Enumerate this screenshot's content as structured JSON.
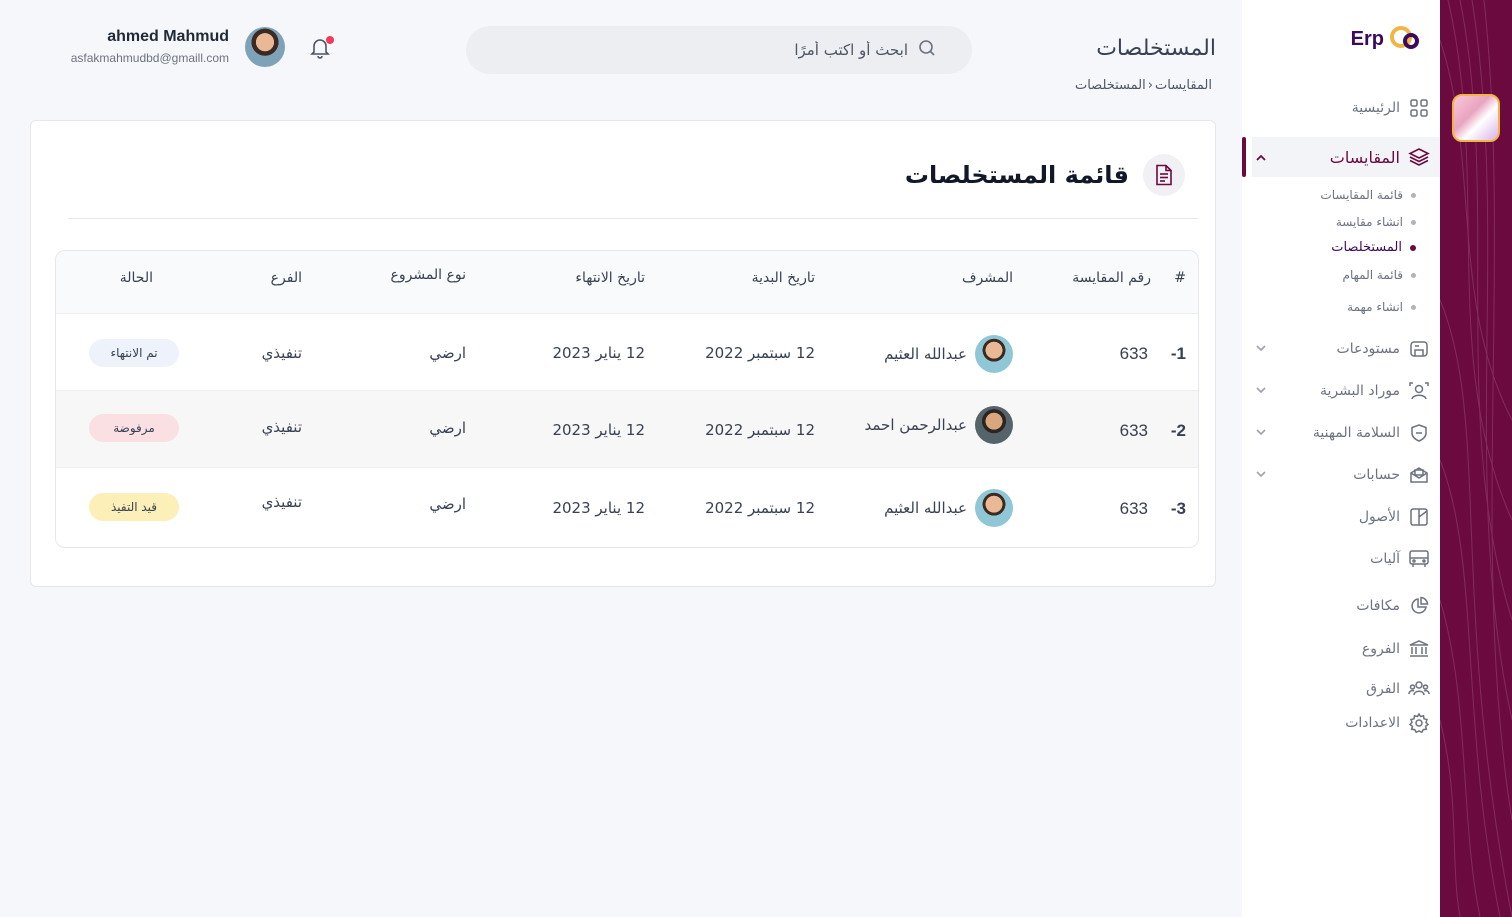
{
  "app": {
    "logo_text": "Erp"
  },
  "sidebar": {
    "items": [
      {
        "label": "الرئيسية",
        "icon": "grid-icon"
      },
      {
        "label": "المقايسات",
        "icon": "layers-icon",
        "active": true
      },
      {
        "label": "مستودعات",
        "icon": "warehouse-icon"
      },
      {
        "label": "موراد البشرية",
        "icon": "users-icon"
      },
      {
        "label": "السلامة المهنية",
        "icon": "shield-icon"
      },
      {
        "label": "حسابات",
        "icon": "mail-open-icon"
      },
      {
        "label": "الأصول",
        "icon": "assets-icon"
      },
      {
        "label": "آليات",
        "icon": "bus-icon"
      },
      {
        "label": "مكافات",
        "icon": "pie-icon"
      },
      {
        "label": "الفروع",
        "icon": "bank-icon"
      },
      {
        "label": "الفرق",
        "icon": "team-icon"
      },
      {
        "label": "الاعدادات",
        "icon": "gear-icon"
      }
    ],
    "subitems": [
      {
        "label": "قائمة المقايسات"
      },
      {
        "label": "انشاء مقايسة"
      },
      {
        "label": "المستخلصات",
        "current": true
      },
      {
        "label": "قائمة المهام"
      },
      {
        "label": "انشاء مهمة"
      }
    ]
  },
  "header": {
    "title": "المستخلصات",
    "breadcrumb": [
      "المقايسات",
      "المستخلصات"
    ],
    "search_placeholder": "ابحث أو اكتب أمرًا",
    "user": {
      "name": "ahmed Mahmud",
      "email": "asfakmahmudbd@gmaill.com"
    }
  },
  "card": {
    "title": "قائمة المستخلصات",
    "table": {
      "headers": [
        "#",
        "رقم المقايسة",
        "المشرف",
        "تاريخ البدية",
        "تاريخ الانتهاء",
        "نوع المشروع",
        "الفرع",
        "الحالة"
      ],
      "rows": [
        {
          "index": "1-",
          "number": "633",
          "supervisor": "عبدالله العثيم",
          "start": "12 سبتمبر 2022",
          "end": "12 يناير 2023",
          "type": "ارضي",
          "branch": "تنفيذي",
          "status": "تم الانتهاء",
          "status_kind": "done"
        },
        {
          "index": "2-",
          "number": "633",
          "supervisor": "عبدالرحمن احمد",
          "start": "12 سبتمبر 2022",
          "end": "12 يناير 2023",
          "type": "ارضي",
          "branch": "تنفيذي",
          "status": "مرفوضة",
          "status_kind": "rejected"
        },
        {
          "index": "3-",
          "number": "633",
          "supervisor": "عبدالله العثيم",
          "start": "12 سبتمبر 2022",
          "end": "12 يناير 2023",
          "type": "ارضي",
          "branch": "تنفيذي",
          "status": "قيد التفيذ",
          "status_kind": "progress"
        }
      ]
    }
  },
  "colors": {
    "brand": "#6b0a3f",
    "brand_dark": "#3b0a5c",
    "accent": "#f2b544",
    "done": "#eef2fb",
    "rejected": "#fbe0e3",
    "progress": "#fcefb7"
  }
}
